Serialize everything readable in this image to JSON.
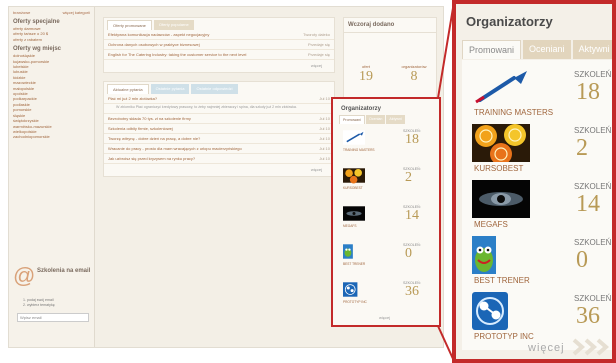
{
  "sidebar": {
    "top_left": "branżowe",
    "top_right": "więcej kategorii",
    "heading_special": "Oferty specjalne",
    "special_links": [
      "oferty darmowe",
      "oferty tańsze o 20 $",
      "oferty z rabatem"
    ],
    "heading_cities": "Oferty wg miejsc",
    "city_links": [
      "dolnośląskie",
      "kujawsko-pomorskie",
      "lubelskie",
      "lubuskie",
      "łódzkie",
      "mazowieckie",
      "małopolskie",
      "opolskie",
      "podkarpackie",
      "podlaskie",
      "pomorskie",
      "śląskie",
      "świętokrzyskie",
      "warmińsko-mazurskie",
      "wielkopolskie",
      "zachodniopomorskie"
    ],
    "promo_title": "Szkolenia na email",
    "promo_line1": "1. podaj swój email",
    "promo_line2": "2. wybierz tematykę",
    "email_placeholder": "Wpisz email"
  },
  "main": {
    "top_tabs": [
      "Oferty promowane",
      "Oferty popularne"
    ],
    "top_rows": [
      {
        "title": "Efektywna komunikacja nadawców - aspekt negocjacyjny",
        "meta": "Tworoty daleko"
      },
      {
        "title": "Ochrona danych osobowych w praktyce biznesowej",
        "meta": "Przedaje się"
      },
      {
        "title": "English for The Catering Industry: taking the customer service to the next level",
        "meta": "Przedaje się"
      }
    ],
    "top_more": "więcej",
    "q_tabs": [
      "Aktualne pytania",
      "Ostatnie pytania",
      "Ostatnie odpowiedzi"
    ],
    "q_rows": [
      {
        "title": "Płać mi już 2 mln złotówka?",
        "date": "Jul 10"
      },
      {
        "title": "Bezrobotny składa 70 tys. zł na szkolenie firmy",
        "date": "Jul 10"
      },
      {
        "title": "Szkolenia odbiły firmie, szkoleniowej",
        "date": "Jul 10"
      },
      {
        "title": "Tworzę witrynę - dobre dzień na pracę, a dobre nie?",
        "date": "Jul 10"
      },
      {
        "title": "Wracanie do pracy - prosto dla mam wracających z urlopu macierzyńskiego",
        "date": "Jul 10"
      },
      {
        "title": "Jak uzbroisz się przed kryzysem na rynku pracy?",
        "date": "Jul 10"
      }
    ],
    "q_sub": "W zbiorniku Płać ograniczyć kredytowy prasowy, to żeby najmniej zbieraczy i spina, dla szkoły już 2 mln złotówka.",
    "q_more": "więcej"
  },
  "added": {
    "title": "Wczoraj dodano",
    "left_label": "ofert",
    "left_value": "19",
    "right_label": "organizatorów",
    "right_value": "8"
  },
  "organizers_small": {
    "title": "Organizatorzy",
    "tabs": [
      "Promowani",
      "Ocenian",
      "Aktywni"
    ],
    "more": "więcej"
  },
  "organizers": {
    "title": "Organizatorzy",
    "tabs": [
      "Promowani",
      "Oceniani",
      "Aktywni"
    ],
    "count_label": "SZKOLEŃ:",
    "items": [
      {
        "name": "TRAINING MASTERS",
        "count": "18",
        "icon": "dart-icon"
      },
      {
        "name": "KURSOBEST",
        "count": "2",
        "icon": "citrus-icon"
      },
      {
        "name": "MEGAFS",
        "count": "14",
        "icon": "eye-icon"
      },
      {
        "name": "BEST TRENER",
        "count": "0",
        "icon": "kermit-icon"
      },
      {
        "name": "PROTOTYP INC",
        "count": "36",
        "icon": "molecule-icon"
      }
    ],
    "more": "więcej"
  },
  "colors": {
    "highlight": "#c32a2a",
    "accent": "#b89a56",
    "link": "#a0663d"
  }
}
